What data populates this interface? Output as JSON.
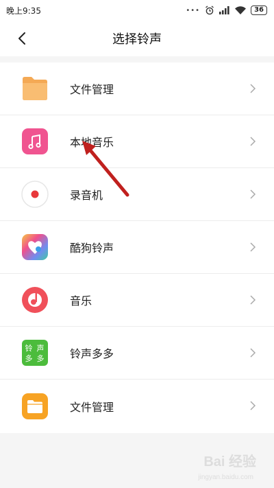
{
  "status_bar": {
    "left_text": "晚上9:35",
    "dots": "•••",
    "icons": [
      "alarm-icon",
      "signal-icon",
      "wifi-icon"
    ],
    "battery": "36"
  },
  "header": {
    "title": "选择铃声",
    "back_icon": "chevron-left-icon"
  },
  "items": [
    {
      "label": "文件管理",
      "icon": "folder-icon",
      "color": "#f8b365"
    },
    {
      "label": "本地音乐",
      "icon": "music-note-icon",
      "color": "#f0508a"
    },
    {
      "label": "录音机",
      "icon": "record-icon",
      "color": "#e8383b"
    },
    {
      "label": "酷狗铃声",
      "icon": "kugou-ringtone-icon",
      "color": "#6cb5f0"
    },
    {
      "label": "音乐",
      "icon": "music-disc-icon",
      "color": "#f0505a"
    },
    {
      "label": "铃声多多",
      "icon": "ringtone-duoduo-icon",
      "color": "#4cbc3c"
    },
    {
      "label": "文件管理",
      "icon": "file-manager-icon",
      "color": "#f7a324"
    }
  ],
  "ringtone_logo_text": [
    "铃",
    "声",
    "多",
    "多"
  ],
  "annotation": {
    "icon": "red-arrow-icon",
    "color": "#c0201e"
  },
  "watermark": {
    "main": "Bai 经验",
    "sub": "jingyan.baidu.com"
  }
}
